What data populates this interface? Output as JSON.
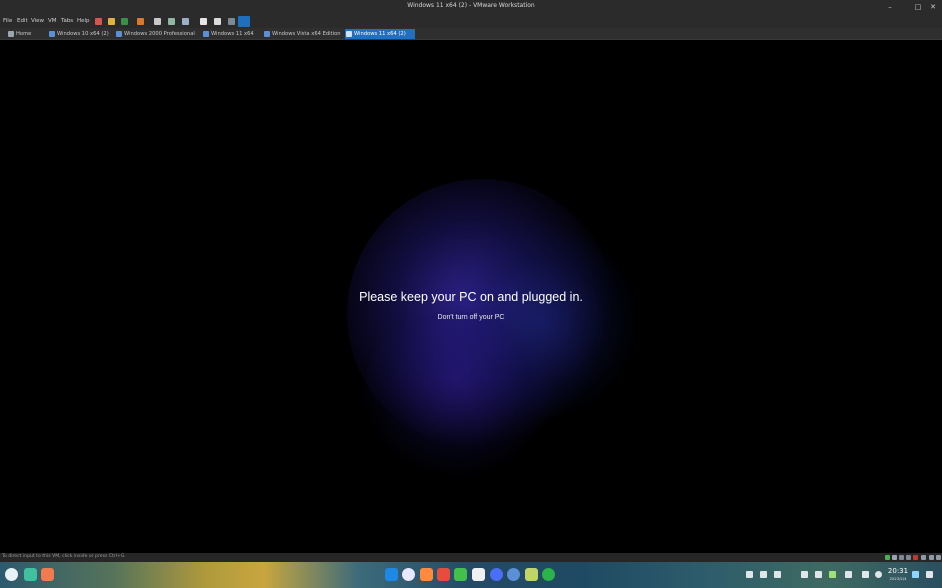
{
  "window": {
    "title": "Windows 11 x64 (2) - VMware Workstation",
    "controls": [
      "minimize-icon",
      "maximize-icon",
      "close-icon"
    ]
  },
  "menu": {
    "items": [
      "File",
      "Edit",
      "View",
      "VM",
      "Tabs",
      "Help"
    ]
  },
  "toolbar": {
    "icons": [
      "stop-icon",
      "pause-icon",
      "power-icon",
      "refresh-icon",
      "snapshot-icon",
      "snapshot-manager-icon",
      "revert-icon",
      "console-icon",
      "fullscreen-icon",
      "unity-icon",
      "view-icon"
    ]
  },
  "tabs": [
    {
      "label": "Home",
      "active": false
    },
    {
      "label": "Windows 10 x64 (2)",
      "active": false
    },
    {
      "label": "Windows 2000 Professional",
      "active": false
    },
    {
      "label": "Windows 11 x64",
      "active": false
    },
    {
      "label": "Windows Vista x64 Edition",
      "active": false
    },
    {
      "label": "Windows 11 x64 (2)",
      "active": true
    }
  ],
  "vm_screen": {
    "main_message": "Please keep your PC on and plugged in.",
    "sub_message": "Don't turn off your PC"
  },
  "statusbar": {
    "hint": "To direct input to this VM, click inside or press Ctrl+G."
  },
  "taskbar": {
    "time": "20:31",
    "date": "2023/2/4",
    "accent": "#1f6fc2"
  }
}
